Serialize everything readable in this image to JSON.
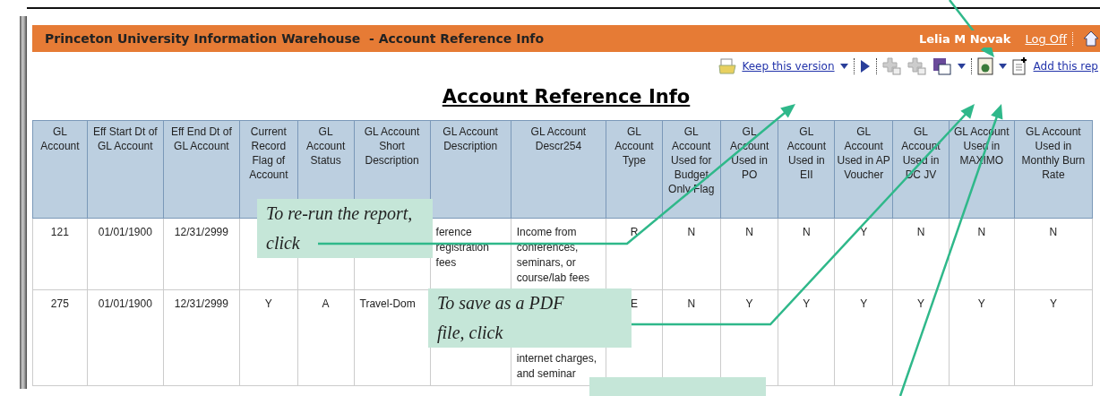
{
  "header": {
    "title": "Princeton University Information Warehouse  - Account Reference Info",
    "user": "Lelia M Novak",
    "logoff": "Log Off"
  },
  "toolbar": {
    "keep_version": "Keep this version",
    "add_report": "Add this rep"
  },
  "report_title": "Account Reference Info",
  "table": {
    "columns": [
      "GL Account",
      "Eff Start Dt of GL Account",
      "Eff End Dt of GL Account",
      "Current Record Flag of Account",
      "GL Account Status",
      "GL Account Short Description",
      "GL Account Description",
      "GL Account Descr254",
      "GL Account Type",
      "GL Account Used for Budget Only Flag",
      "GL Account Used in PO",
      "GL Account Used in EII",
      "GL Account Used in AP Voucher",
      "GL Account Used in DC JV",
      "GL Account Used in MAXIMO",
      "GL Account Used in Monthly Burn Rate"
    ],
    "rows": [
      {
        "cells": [
          {
            "text": "121"
          },
          {
            "text": "01/01/1900"
          },
          {
            "text": "12/31/2999"
          },
          {},
          {},
          {},
          {
            "text": "ference registration fees"
          },
          {
            "text": "Income from conferences, seminars, or course/lab fees"
          },
          {
            "text": "R"
          },
          {
            "text": "N"
          },
          {
            "text": "N"
          },
          {
            "text": "N"
          },
          {
            "text": "Y"
          },
          {
            "text": "N"
          },
          {
            "text": "N"
          },
          {
            "text": "N"
          }
        ]
      },
      {
        "cells": [
          {
            "text": "275"
          },
          {
            "text": "01/01/1900"
          },
          {
            "text": "12/31/2999"
          },
          {
            "text": "Y"
          },
          {
            "text": "A"
          },
          {
            "text": "Travel-Dom"
          },
          {},
          {
            "text": "internet charges, and seminar"
          },
          {
            "text": "E"
          },
          {
            "text": "N"
          },
          {
            "text": "Y"
          },
          {
            "text": "Y"
          },
          {
            "text": "Y"
          },
          {
            "text": "Y"
          },
          {
            "text": "Y"
          },
          {
            "text": "Y"
          }
        ]
      }
    ]
  },
  "callouts": [
    {
      "text": "To re-run the report,\nclick"
    },
    {
      "text": "To save as a PDF\nfile, click"
    }
  ]
}
